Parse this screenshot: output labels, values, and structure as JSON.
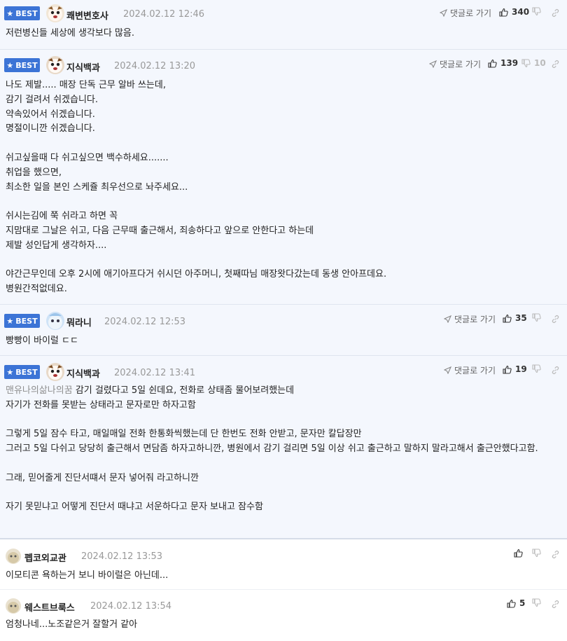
{
  "labels": {
    "best": "BEST",
    "reply": "댓글로 가기"
  },
  "comments": [
    {
      "nick": "쾌변변호사",
      "date": "2024.02.12 12:46",
      "up": "340",
      "down": "",
      "text": "저런병신들 세상에 생각보다 많음."
    },
    {
      "nick": "지식백과",
      "date": "2024.02.12 13:20",
      "up": "139",
      "down": "10",
      "text": "나도 제발..... 매장 단독 근무 알바 쓰는데,\n감기 걸려서 쉬겠습니다.\n약속있어서 쉬겠습니다.\n명절이니깐 쉬겠습니다.\n\n쉬고싶을때 다 쉬고싶으면 백수하세요.......\n취업을 했으면,\n최소한 일을 본인 스케쥴 최우선으로 놔주세요...\n\n쉬시는김에 쭉 쉬라고 하면 꼭\n지맘대로 그날은 쉬고, 다음 근무때 출근해서, 죄송하다고 앞으로 안한다고 하는데\n제발 성인답게 생각하자....\n\n야간근무인데 오후 2시에 애기아프다거 쉬시던 아주머니, 첫째따님 매장왓다갔는데 동생 안아프데요.\n병원간적없데요."
    },
    {
      "nick": "뭐라니",
      "date": "2024.02.12 12:53",
      "up": "35",
      "down": "",
      "text": "빵빵이 바이럴 ㄷㄷ"
    },
    {
      "nick": "지식백과",
      "date": "2024.02.12 13:41",
      "up": "19",
      "down": "",
      "mention": "맨유나의삶나의꿈",
      "text": " 감기 걸렸다고 5일 쉰데요, 전화로 상태좀 물어보려했는데\n자기가 전화를 못받는 상태라고 문자로만 하자고함\n\n그렇게 5일 잠수 타고, 매일매일 전화 한통화씩했는데 단 한번도 전화 안받고, 문자만 칼답장만\n그러고 5일 다쉬고 당당히 출근해서 면담좀 하자고하니깐, 병원에서 감기 걸리면 5일 이상 쉬고 출근하고 말하지 말라고해서 출근안했다고함.\n\n그래, 믿어줄게 진단서떄서 문자 넣어줘 라고하니깐\n\n자기 못믿냐고 어떻게 진단서 때냐고 서운하다고 문자 보내고 잠수함"
    },
    {
      "nick": "펩코외교관",
      "date": "2024.02.12 13:53",
      "up": "",
      "down": "",
      "text": "이모티콘 욕하는거 보니 바이럴은 아닌데..."
    },
    {
      "nick": "웨스트브룩스",
      "date": "2024.02.12 13:54",
      "up": "5",
      "down": "",
      "text": "엄청나네...노조같은거 잘할거 같아"
    }
  ]
}
